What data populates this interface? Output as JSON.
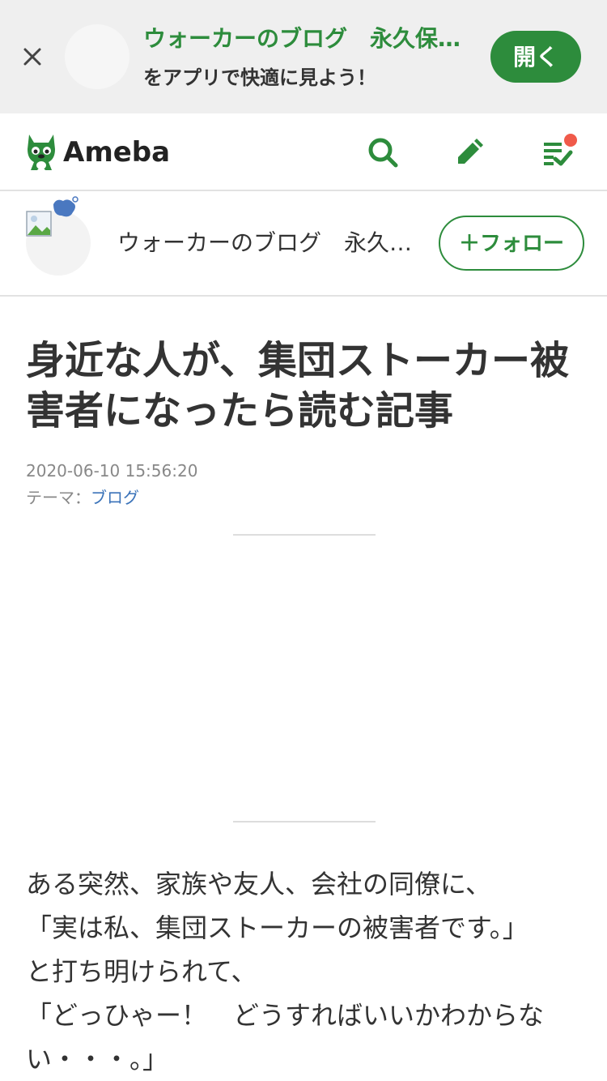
{
  "app_banner": {
    "title": "ウォーカーのブログ　永久保存版　集団ストーカー被害者の真実",
    "subtitle": "をアプリで快適に見よう！",
    "open_label": "開く"
  },
  "header": {
    "logo_text": "Ameba",
    "icons": [
      "search-icon",
      "pencil-icon",
      "checklist-icon"
    ],
    "notification_color": "#f05a4a"
  },
  "owner": {
    "name": "ウォーカーのブログ　永久保存版　集団ストーカー被害者の真実",
    "follow_label": "＋フォロー"
  },
  "article": {
    "title": "身近な人が、集団ストーカー被害者になったら読む記事",
    "date": "2020-06-10 15:56:20",
    "theme_label": "テーマ：",
    "theme_value": "ブログ",
    "body_lines": [
      "ある突然、家族や友人、会社の同僚に、",
      "「実は私、集団ストーカーの被害者です。」",
      "と打ち明けられて、",
      "「どっひゃー！　どうすればいいかわからな",
      "い・・・。」"
    ]
  },
  "colors": {
    "brand_green": "#2d8c3c",
    "link_blue": "#3b73b9",
    "banner_bg": "#efefef"
  }
}
